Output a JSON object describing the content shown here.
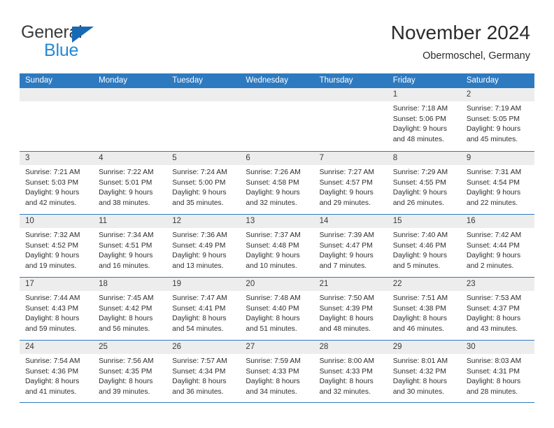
{
  "brand": {
    "name_part1": "General",
    "name_part2": "Blue",
    "flag_icon": "triangle-flag-icon",
    "color_dark": "#3b3b3b",
    "color_blue": "#2389d6",
    "color_flag": "#1569b5"
  },
  "header": {
    "title": "November 2024",
    "subtitle": "Obermoschel, Germany"
  },
  "theme": {
    "header_blue": "#2e7ac0",
    "day_head_gray": "#ededed",
    "text": "#2d2d2d"
  },
  "calendar": {
    "weekdays": [
      "Sunday",
      "Monday",
      "Tuesday",
      "Wednesday",
      "Thursday",
      "Friday",
      "Saturday"
    ],
    "weeks": [
      [
        {
          "empty": true,
          "date": "",
          "lines": []
        },
        {
          "empty": true,
          "date": "",
          "lines": []
        },
        {
          "empty": true,
          "date": "",
          "lines": []
        },
        {
          "empty": true,
          "date": "",
          "lines": []
        },
        {
          "empty": true,
          "date": "",
          "lines": []
        },
        {
          "empty": false,
          "date": "1",
          "lines": [
            "Sunrise: 7:18 AM",
            "Sunset: 5:06 PM",
            "Daylight: 9 hours",
            "and 48 minutes."
          ]
        },
        {
          "empty": false,
          "date": "2",
          "lines": [
            "Sunrise: 7:19 AM",
            "Sunset: 5:05 PM",
            "Daylight: 9 hours",
            "and 45 minutes."
          ]
        }
      ],
      [
        {
          "empty": false,
          "date": "3",
          "lines": [
            "Sunrise: 7:21 AM",
            "Sunset: 5:03 PM",
            "Daylight: 9 hours",
            "and 42 minutes."
          ]
        },
        {
          "empty": false,
          "date": "4",
          "lines": [
            "Sunrise: 7:22 AM",
            "Sunset: 5:01 PM",
            "Daylight: 9 hours",
            "and 38 minutes."
          ]
        },
        {
          "empty": false,
          "date": "5",
          "lines": [
            "Sunrise: 7:24 AM",
            "Sunset: 5:00 PM",
            "Daylight: 9 hours",
            "and 35 minutes."
          ]
        },
        {
          "empty": false,
          "date": "6",
          "lines": [
            "Sunrise: 7:26 AM",
            "Sunset: 4:58 PM",
            "Daylight: 9 hours",
            "and 32 minutes."
          ]
        },
        {
          "empty": false,
          "date": "7",
          "lines": [
            "Sunrise: 7:27 AM",
            "Sunset: 4:57 PM",
            "Daylight: 9 hours",
            "and 29 minutes."
          ]
        },
        {
          "empty": false,
          "date": "8",
          "lines": [
            "Sunrise: 7:29 AM",
            "Sunset: 4:55 PM",
            "Daylight: 9 hours",
            "and 26 minutes."
          ]
        },
        {
          "empty": false,
          "date": "9",
          "lines": [
            "Sunrise: 7:31 AM",
            "Sunset: 4:54 PM",
            "Daylight: 9 hours",
            "and 22 minutes."
          ]
        }
      ],
      [
        {
          "empty": false,
          "date": "10",
          "lines": [
            "Sunrise: 7:32 AM",
            "Sunset: 4:52 PM",
            "Daylight: 9 hours",
            "and 19 minutes."
          ]
        },
        {
          "empty": false,
          "date": "11",
          "lines": [
            "Sunrise: 7:34 AM",
            "Sunset: 4:51 PM",
            "Daylight: 9 hours",
            "and 16 minutes."
          ]
        },
        {
          "empty": false,
          "date": "12",
          "lines": [
            "Sunrise: 7:36 AM",
            "Sunset: 4:49 PM",
            "Daylight: 9 hours",
            "and 13 minutes."
          ]
        },
        {
          "empty": false,
          "date": "13",
          "lines": [
            "Sunrise: 7:37 AM",
            "Sunset: 4:48 PM",
            "Daylight: 9 hours",
            "and 10 minutes."
          ]
        },
        {
          "empty": false,
          "date": "14",
          "lines": [
            "Sunrise: 7:39 AM",
            "Sunset: 4:47 PM",
            "Daylight: 9 hours",
            "and 7 minutes."
          ]
        },
        {
          "empty": false,
          "date": "15",
          "lines": [
            "Sunrise: 7:40 AM",
            "Sunset: 4:46 PM",
            "Daylight: 9 hours",
            "and 5 minutes."
          ]
        },
        {
          "empty": false,
          "date": "16",
          "lines": [
            "Sunrise: 7:42 AM",
            "Sunset: 4:44 PM",
            "Daylight: 9 hours",
            "and 2 minutes."
          ]
        }
      ],
      [
        {
          "empty": false,
          "date": "17",
          "lines": [
            "Sunrise: 7:44 AM",
            "Sunset: 4:43 PM",
            "Daylight: 8 hours",
            "and 59 minutes."
          ]
        },
        {
          "empty": false,
          "date": "18",
          "lines": [
            "Sunrise: 7:45 AM",
            "Sunset: 4:42 PM",
            "Daylight: 8 hours",
            "and 56 minutes."
          ]
        },
        {
          "empty": false,
          "date": "19",
          "lines": [
            "Sunrise: 7:47 AM",
            "Sunset: 4:41 PM",
            "Daylight: 8 hours",
            "and 54 minutes."
          ]
        },
        {
          "empty": false,
          "date": "20",
          "lines": [
            "Sunrise: 7:48 AM",
            "Sunset: 4:40 PM",
            "Daylight: 8 hours",
            "and 51 minutes."
          ]
        },
        {
          "empty": false,
          "date": "21",
          "lines": [
            "Sunrise: 7:50 AM",
            "Sunset: 4:39 PM",
            "Daylight: 8 hours",
            "and 48 minutes."
          ]
        },
        {
          "empty": false,
          "date": "22",
          "lines": [
            "Sunrise: 7:51 AM",
            "Sunset: 4:38 PM",
            "Daylight: 8 hours",
            "and 46 minutes."
          ]
        },
        {
          "empty": false,
          "date": "23",
          "lines": [
            "Sunrise: 7:53 AM",
            "Sunset: 4:37 PM",
            "Daylight: 8 hours",
            "and 43 minutes."
          ]
        }
      ],
      [
        {
          "empty": false,
          "date": "24",
          "lines": [
            "Sunrise: 7:54 AM",
            "Sunset: 4:36 PM",
            "Daylight: 8 hours",
            "and 41 minutes."
          ]
        },
        {
          "empty": false,
          "date": "25",
          "lines": [
            "Sunrise: 7:56 AM",
            "Sunset: 4:35 PM",
            "Daylight: 8 hours",
            "and 39 minutes."
          ]
        },
        {
          "empty": false,
          "date": "26",
          "lines": [
            "Sunrise: 7:57 AM",
            "Sunset: 4:34 PM",
            "Daylight: 8 hours",
            "and 36 minutes."
          ]
        },
        {
          "empty": false,
          "date": "27",
          "lines": [
            "Sunrise: 7:59 AM",
            "Sunset: 4:33 PM",
            "Daylight: 8 hours",
            "and 34 minutes."
          ]
        },
        {
          "empty": false,
          "date": "28",
          "lines": [
            "Sunrise: 8:00 AM",
            "Sunset: 4:33 PM",
            "Daylight: 8 hours",
            "and 32 minutes."
          ]
        },
        {
          "empty": false,
          "date": "29",
          "lines": [
            "Sunrise: 8:01 AM",
            "Sunset: 4:32 PM",
            "Daylight: 8 hours",
            "and 30 minutes."
          ]
        },
        {
          "empty": false,
          "date": "30",
          "lines": [
            "Sunrise: 8:03 AM",
            "Sunset: 4:31 PM",
            "Daylight: 8 hours",
            "and 28 minutes."
          ]
        }
      ]
    ]
  }
}
